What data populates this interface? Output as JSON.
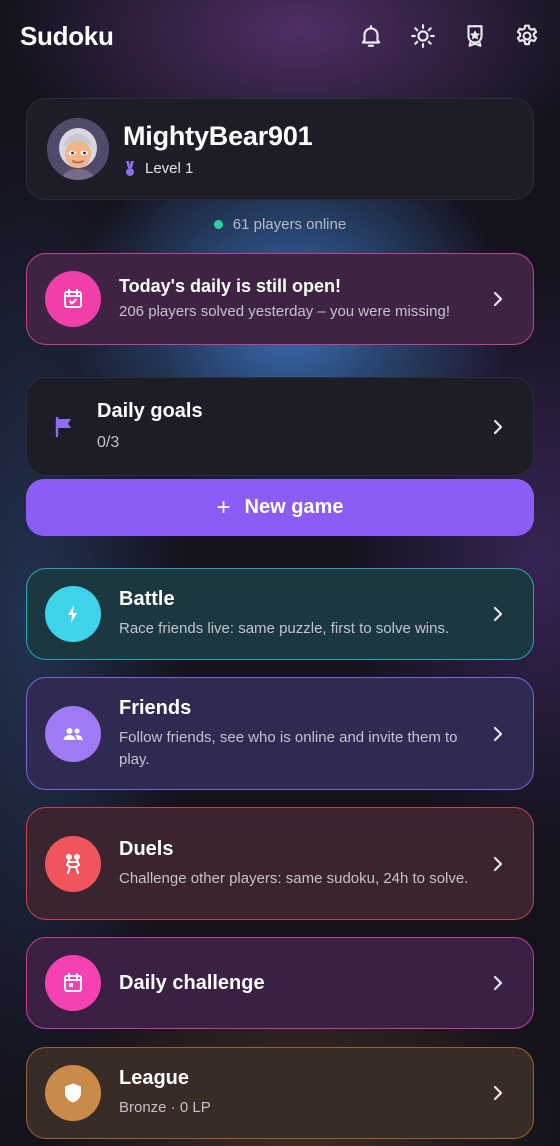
{
  "header": {
    "title": "Sudoku",
    "icons": [
      "bell-icon",
      "sun-icon",
      "award-icon",
      "gear-icon"
    ]
  },
  "profile": {
    "username": "MightyBear901",
    "level": "Level 1"
  },
  "online": {
    "text": "61 players online",
    "dot_color": "#2fd0a0"
  },
  "daily_banner": {
    "title": "Today's daily is still open!",
    "subtitle": "206 players solved yesterday – you were missing!",
    "icon": "calendar-check-icon",
    "color": "#f03fa8"
  },
  "goals": {
    "title": "Daily goals",
    "progress": "0/3",
    "icon": "flag-icon"
  },
  "new_game": {
    "label": "New game",
    "color": "#8b5cf6"
  },
  "modes": [
    {
      "title": "Battle",
      "subtitle": "Race friends live: same puzzle, first to solve wins.",
      "icon": "bolt-icon",
      "color": "#3ed3e8"
    },
    {
      "title": "Friends",
      "subtitle": "Follow friends, see who is online and invite them to play.",
      "icon": "people-icon",
      "color": "#a079f5"
    },
    {
      "title": "Duels",
      "subtitle": "Challenge other players: same sudoku, 24h to solve.",
      "icon": "wrestling-icon",
      "color": "#f0545c"
    },
    {
      "title": "Daily challenge",
      "subtitle": "",
      "icon": "calendar-icon",
      "color": "#f542b3"
    },
    {
      "title": "League",
      "subtitle": "Bronze · 0 LP",
      "icon": "shield-icon",
      "color": "#c98a4a"
    }
  ]
}
